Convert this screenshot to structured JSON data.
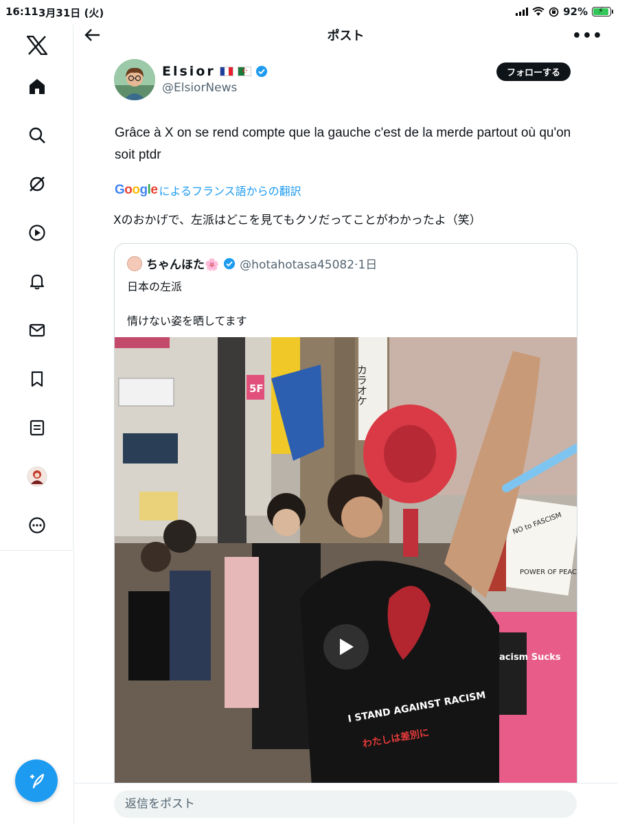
{
  "status_bar": {
    "time": "16:11",
    "date": "3月31日 (火)",
    "battery": "92%"
  },
  "header": {
    "title": "ポスト"
  },
  "sidebar": {
    "items": [
      {
        "icon": "x-logo-icon"
      },
      {
        "icon": "home-icon"
      },
      {
        "icon": "search-icon"
      },
      {
        "icon": "grok-icon"
      },
      {
        "icon": "video-icon"
      },
      {
        "icon": "bell-icon"
      },
      {
        "icon": "mail-icon"
      },
      {
        "icon": "bookmark-icon"
      },
      {
        "icon": "lists-icon"
      },
      {
        "icon": "profile-avatar"
      },
      {
        "icon": "more-circle-icon"
      }
    ],
    "compose_icon": "compose-icon"
  },
  "post": {
    "author_name": "Elsior",
    "author_handle": "@ElsiorNews",
    "follow_label": "フォローする",
    "text": "Grâce à X on se rend compte que la gauche c'est de la merde partout où qu'on soit ptdr",
    "google": "Google",
    "translate_label": "によるフランス語からの翻訳",
    "translated_text": "Xのおかげで、左派はどこを見てもクソだってことがわかったよ（笑）"
  },
  "quote": {
    "name": "ちゃんほた🌸",
    "handle_time": "@hotahotasa45082·1日",
    "line1": "日本の左派",
    "line2": "情けない姿を晒してます",
    "video_signs": {
      "karaoke": "カラオケ",
      "floor": "5F",
      "no_fascism": "NO to FASCISM",
      "power_of_peace": "POWER OF PEACE",
      "racism_sucks": "Racism Sucks",
      "shirt1": "I STAND AGAINST RACISM",
      "shirt2": "わたしは差別に"
    }
  },
  "reply": {
    "placeholder": "返信をポスト"
  },
  "colors": {
    "accent": "#1d9bf0",
    "text": "#0f1419",
    "muted": "#536471"
  }
}
